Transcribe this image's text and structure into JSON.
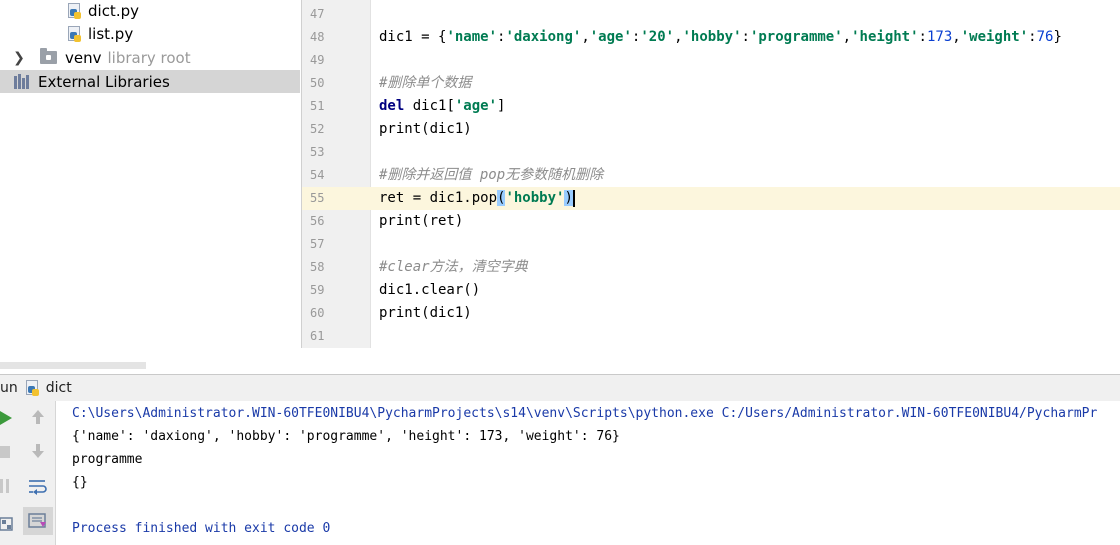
{
  "project_tree": {
    "items": [
      {
        "label": "dict.py",
        "kind": "python-file"
      },
      {
        "label": "list.py",
        "kind": "python-file"
      },
      {
        "label": "venv",
        "suffix": "library root",
        "kind": "folder"
      },
      {
        "label": "External Libraries",
        "kind": "libraries"
      }
    ]
  },
  "editor": {
    "current_line": "55",
    "lines": [
      {
        "n": "47",
        "code": ""
      },
      {
        "n": "48",
        "code": "dic1 = {'name':'daxiong','age':'20','hobby':'programme','height':173,'weight':76}"
      },
      {
        "n": "49",
        "code": ""
      },
      {
        "n": "50",
        "code": "#删除单个数据"
      },
      {
        "n": "51",
        "code": "del dic1['age']"
      },
      {
        "n": "52",
        "code": "print(dic1)"
      },
      {
        "n": "53",
        "code": ""
      },
      {
        "n": "54",
        "code": "#删除并返回值 pop无参数随机删除"
      },
      {
        "n": "55",
        "code": "ret = dic1.pop('hobby')"
      },
      {
        "n": "56",
        "code": "print(ret)"
      },
      {
        "n": "57",
        "code": ""
      },
      {
        "n": "58",
        "code": "#clear方法，清空字典"
      },
      {
        "n": "59",
        "code": "dic1.clear()"
      },
      {
        "n": "60",
        "code": "print(dic1)"
      },
      {
        "n": "61",
        "code": ""
      }
    ]
  },
  "run_window": {
    "label": "un",
    "config_name": "dict",
    "console": {
      "command": "C:\\Users\\Administrator.WIN-60TFE0NIBU4\\PycharmProjects\\s14\\venv\\Scripts\\python.exe C:/Users/Administrator.WIN-60TFE0NIBU4/PycharmPr",
      "output": [
        "{'name': 'daxiong', 'hobby': 'programme', 'height': 173, 'weight': 76}",
        "programme",
        "{}"
      ],
      "exit_message": "Process finished with exit code 0"
    }
  },
  "colors": {
    "string": "#007b52",
    "keyword": "#000080",
    "number": "#0a3fd1",
    "comment": "#8c8c8c",
    "current_line": "#fcf6dd",
    "run_green": "#3c9a3c"
  }
}
